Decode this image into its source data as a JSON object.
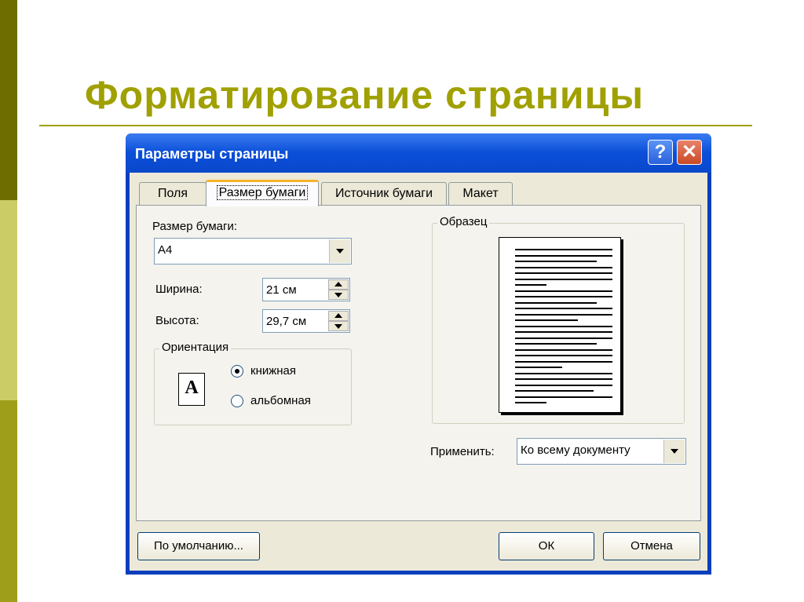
{
  "slide": {
    "title": "Форматирование страницы"
  },
  "dialog": {
    "title": "Параметры страницы",
    "tabs": [
      {
        "label": "Поля"
      },
      {
        "label": "Размер бумаги"
      },
      {
        "label": "Источник бумаги"
      },
      {
        "label": "Макет"
      }
    ],
    "active_tab": "Размер бумаги",
    "paper_size": {
      "label": "Размер бумаги:",
      "value": "A4"
    },
    "width": {
      "label": "Ширина:",
      "value": "21 см"
    },
    "height": {
      "label": "Высота:",
      "value": "29,7 см"
    },
    "orientation": {
      "title": "Ориентация",
      "icon_letter": "A",
      "options": [
        {
          "label": "книжная",
          "checked": true
        },
        {
          "label": "альбомная",
          "checked": false
        }
      ]
    },
    "preview": {
      "title": "Образец"
    },
    "apply": {
      "label": "Применить:",
      "value": "Ко всему документу"
    },
    "buttons": {
      "default": "По умолчанию...",
      "ok": "ОК",
      "cancel": "Отмена"
    }
  },
  "colors": {
    "accent": "#a0a000",
    "titlebar": "#0a4ed8",
    "dialog_bg": "#ece9d8"
  }
}
